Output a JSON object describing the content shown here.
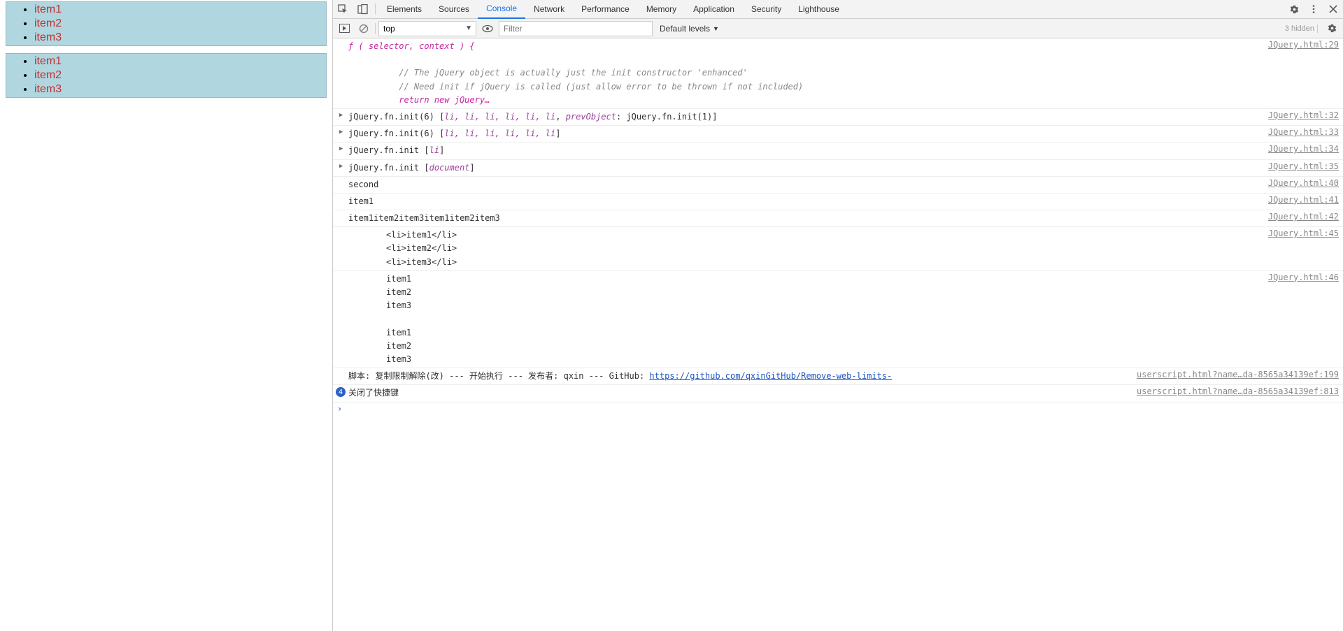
{
  "page": {
    "lists": [
      {
        "items": [
          "item1",
          "item2",
          "item3"
        ]
      },
      {
        "items": [
          "item1",
          "item2",
          "item3"
        ]
      }
    ]
  },
  "devtools": {
    "tabs": [
      "Elements",
      "Sources",
      "Console",
      "Network",
      "Performance",
      "Memory",
      "Application",
      "Security",
      "Lighthouse"
    ],
    "active_tab": "Console",
    "toolbar": {
      "context_value": "top",
      "filter_placeholder": "Filter",
      "levels_label": "Default levels",
      "hidden_text": "3 hidden"
    },
    "console": {
      "func_header": "ƒ ( selector, context ) {",
      "func_comment_1": "// The jQuery object is actually just the init constructor 'enhanced'",
      "func_comment_2": "// Need init if jQuery is called (just allow error to be thrown if not included)",
      "func_return": "return new jQuery…",
      "func_src": "JQuery.html:29",
      "init6a_prefix": "jQuery.fn.init(6)",
      "init6a_items": "li, li, li, li, li, li",
      "init6a_prev_k": "prevObject",
      "init6a_prev_v": "jQuery.fn.init(1)",
      "init6a_src": "JQuery.html:32",
      "init6b_prefix": "jQuery.fn.init(6)",
      "init6b_items": "li, li, li, li, li, li",
      "init6b_src": "JQuery.html:33",
      "initli_prefix": "jQuery.fn.init",
      "initli_item": "li",
      "initli_src": "JQuery.html:34",
      "initdoc_prefix": "jQuery.fn.init",
      "initdoc_item": "document",
      "initdoc_src": "JQuery.html:35",
      "second_msg": "second",
      "second_src": "JQuery.html:40",
      "item1_msg": "item1",
      "item1_src": "JQuery.html:41",
      "allitems_msg": "item1item2item3item1item2item3",
      "allitems_src": "JQuery.html:42",
      "lihtml_msg": "<li>item1</li>\n<li>item2</li>\n<li>item3</li>",
      "lihtml_src": "JQuery.html:45",
      "textblock_msg": "item1\nitem2\nitem3\n\nitem1\nitem2\nitem3",
      "textblock_src": "JQuery.html:46",
      "script_prefix": "脚本: 复制限制解除(改) --- 开始执行 --- 发布者: qxin --- GitHub: ",
      "script_link": "https://github.com/qxinGitHub/Remove-web-limits-",
      "script_src": "userscript.html?name…da-8565a34139ef:199",
      "info_badge": "4",
      "info_msg": "关闭了快捷键",
      "info_src": "userscript.html?name…da-8565a34139ef:813"
    }
  }
}
